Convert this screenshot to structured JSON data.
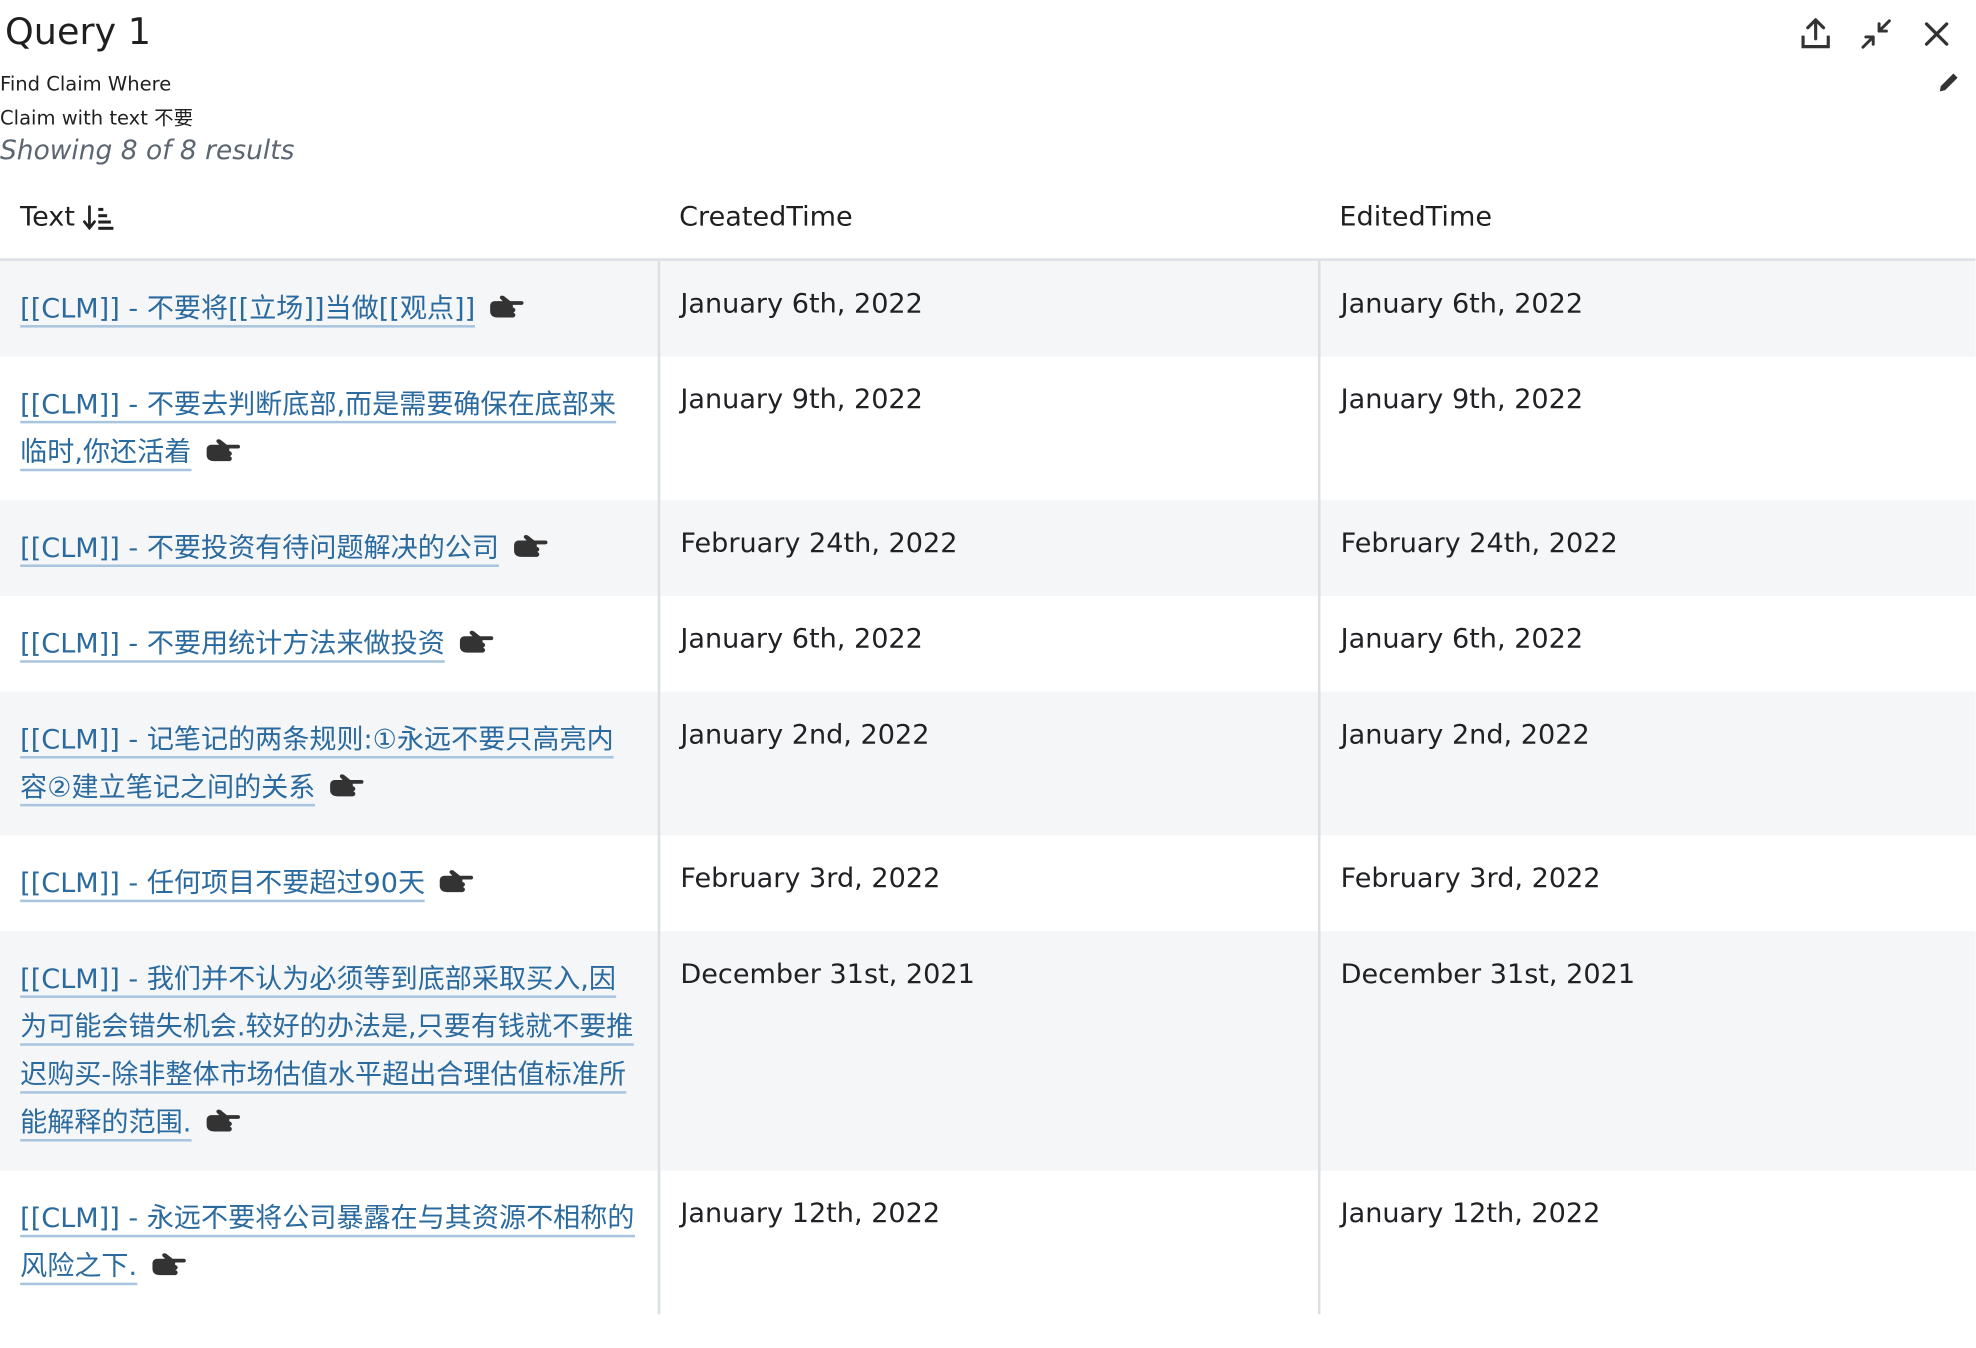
{
  "header": {
    "title": "Query 1",
    "query_lines": [
      "Find Claim Where",
      "Claim with text 不要"
    ],
    "results_text": "Showing 8 of 8 results"
  },
  "toolbar": {
    "icons": [
      "share-upload-icon",
      "minimize-icon",
      "close-icon",
      "pencil-icon"
    ]
  },
  "table": {
    "columns": [
      {
        "label": "Text",
        "sort": "descending"
      },
      {
        "label": "CreatedTime"
      },
      {
        "label": "EditedTime"
      }
    ],
    "rows": [
      {
        "text": "[[CLM]] - 不要将[[立场]]当做[[观点]]",
        "created": "January 6th, 2022",
        "edited": "January 6th, 2022"
      },
      {
        "text": "[[CLM]] - 不要去判断底部,而是需要确保在底部来临时,你还活着",
        "created": "January 9th, 2022",
        "edited": "January 9th, 2022"
      },
      {
        "text": "[[CLM]] - 不要投资有待问题解决的公司",
        "created": "February 24th, 2022",
        "edited": "February 24th, 2022"
      },
      {
        "text": "[[CLM]] - 不要用统计方法来做投资",
        "created": "January 6th, 2022",
        "edited": "January 6th, 2022"
      },
      {
        "text": "[[CLM]] - 记笔记的两条规则:①永远不要只高亮内容②建立笔记之间的关系",
        "created": "January 2nd, 2022",
        "edited": "January 2nd, 2022"
      },
      {
        "text": "[[CLM]] - 任何项目不要超过90天",
        "created": "February 3rd, 2022",
        "edited": "February 3rd, 2022"
      },
      {
        "text": "[[CLM]] - 我们并不认为必须等到底部采取买入,因为可能会错失机会.较好的办法是,只要有钱就不要推迟购买-除非整体市场估值水平超出合理估值标准所能解释的范围.",
        "created": "December 31st, 2021",
        "edited": "December 31st, 2021"
      },
      {
        "text": "[[CLM]] - 永远不要将公司暴露在与其资源不相称的风险之下.",
        "created": "January 12th, 2022",
        "edited": "January 12th, 2022"
      }
    ]
  },
  "colors": {
    "link": "#2b6a9e",
    "link_underline": "#a9c4de",
    "row_alt": "#f4f6f8",
    "border": "#dcdfe3",
    "muted": "#5c6670"
  }
}
